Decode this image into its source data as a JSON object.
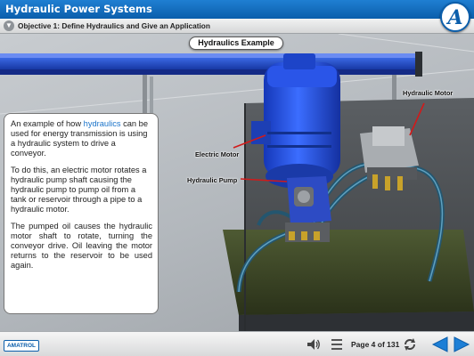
{
  "header": {
    "title": "Hydraulic Power Systems",
    "logo_letter": "A"
  },
  "objective": {
    "text": "Objective 1: Define Hydraulics and Give an Application"
  },
  "scene": {
    "title": "Hydraulics Example",
    "labels": {
      "electric_motor": "Electric Motor",
      "hydraulic_pump": "Hydraulic Pump",
      "hydraulic_motor": "Hydraulic Motor"
    }
  },
  "content": {
    "p1_before": "An example of how ",
    "p1_link": "hydraulics",
    "p1_after": " can be used for energy transmission is using a hydraulic system to drive a conveyor.",
    "p2": "To do this, an electric motor rotates a hydraulic pump shaft causing the hydraulic pump to pump oil from a tank or reservoir through a pipe to a hydraulic motor.",
    "p3": "The pumped oil causes the hydraulic motor shaft to rotate, turning the conveyor drive. Oil leaving the motor returns to the reservoir to be used again."
  },
  "footer": {
    "brand": "AMATROL",
    "page_text": "Page 4 of 131",
    "icons": [
      "speaker-icon",
      "menu-icon",
      "refresh-icon",
      "previous-arrow-icon",
      "next-arrow-icon"
    ]
  },
  "colors": {
    "accent": "#0b5eab",
    "motor_blue": "#1f4fd6",
    "link": "#1a73c9",
    "pointer": "#d21a1a"
  }
}
